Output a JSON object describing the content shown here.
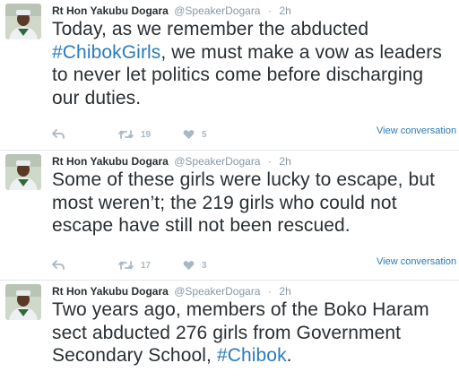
{
  "tweets": [
    {
      "author_name": "Rt Hon Yakubu Dogara",
      "handle": "@SpeakerDogara",
      "separator": "·",
      "time": "2h",
      "text_before": "Today, as we remember the abducted ",
      "hashtag": "#ChibokGirls",
      "text_after": ", we must make a vow as leaders to never let politics come before discharging our duties.",
      "retweets": "19",
      "likes": "5",
      "view_conversation": "View conversation"
    },
    {
      "author_name": "Rt Hon Yakubu Dogara",
      "handle": "@SpeakerDogara",
      "separator": "·",
      "time": "2h",
      "text_before": "Some of these girls were lucky to escape, but most weren’t; the 219 girls who could not escape have still not been rescued.",
      "hashtag": "",
      "text_after": "",
      "retweets": "17",
      "likes": "3",
      "view_conversation": "View conversation"
    },
    {
      "author_name": "Rt Hon Yakubu Dogara",
      "handle": "@SpeakerDogara",
      "separator": "·",
      "time": "2h",
      "text_before": "Two years ago, members of the Boko Haram sect abducted 276 girls from Government Secondary School, ",
      "hashtag": "#Chibok",
      "text_after": ".",
      "retweets": "",
      "likes": "",
      "view_conversation": ""
    }
  ],
  "colors": {
    "text": "#292f33",
    "secondary": "#8899a6",
    "link": "#2b7bb9",
    "action_icon": "#aab8c2",
    "divider": "#e1e8ed"
  },
  "icons": {
    "reply": "reply-icon",
    "retweet": "retweet-icon",
    "like": "heart-icon"
  }
}
